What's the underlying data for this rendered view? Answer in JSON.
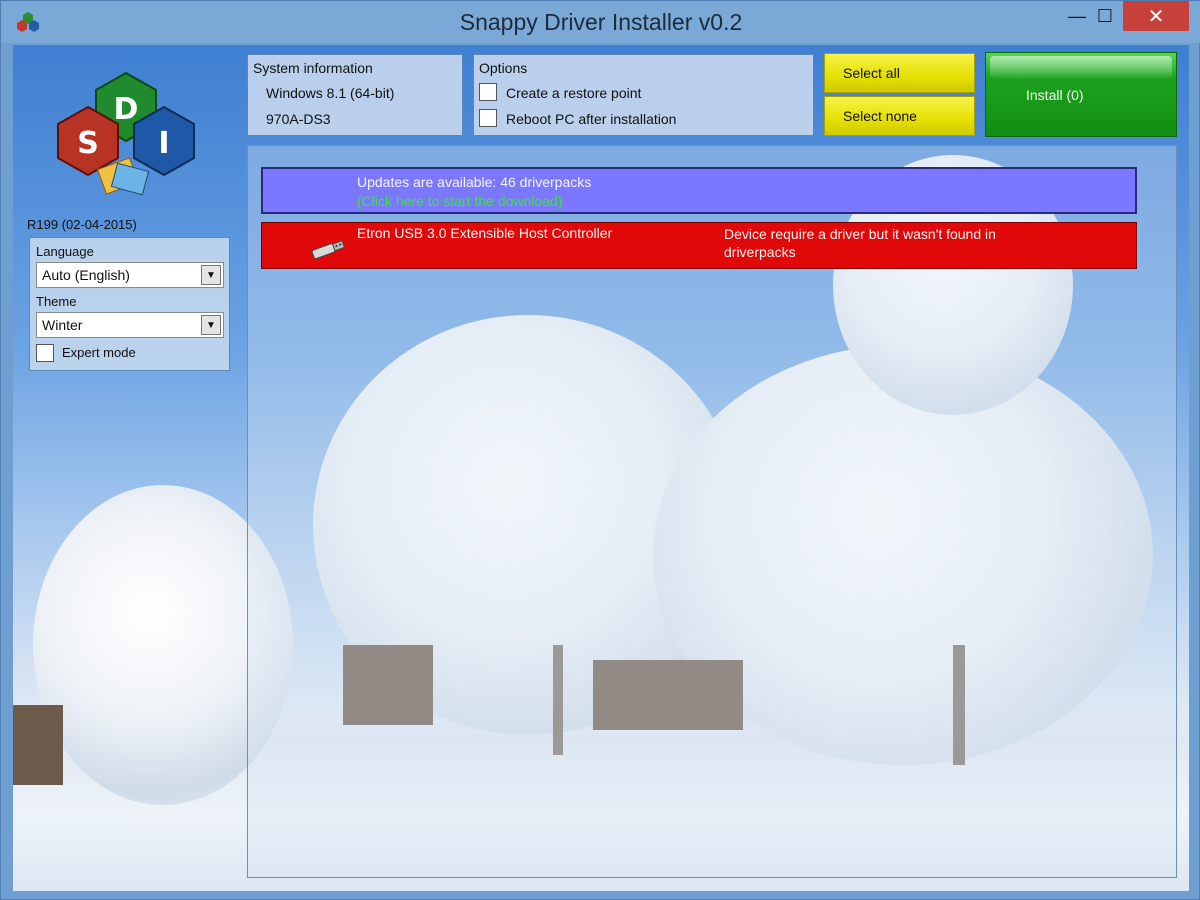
{
  "window": {
    "title": "Snappy Driver Installer v0.2",
    "controls": {
      "minimize": "—",
      "maximize": "☐",
      "close": "✕"
    }
  },
  "sidebar": {
    "revision": "R199 (02-04-2015)",
    "language_label": "Language",
    "language_value": "Auto (English)",
    "theme_label": "Theme",
    "theme_value": "Winter",
    "expert_mode_label": "Expert mode",
    "logo_letters": [
      "D",
      "S",
      "I"
    ]
  },
  "system_info": {
    "title": "System information",
    "os": "Windows 8.1 (64-bit)",
    "board": "970A-DS3"
  },
  "options": {
    "title": "Options",
    "restore_point_label": "Create a restore point",
    "reboot_label": "Reboot PC after installation"
  },
  "buttons": {
    "select_all": "Select all",
    "select_none": "Select none",
    "install": "Install (0)"
  },
  "list": {
    "update_title": "Updates are available: 46 driverpacks",
    "update_link": "(Click here to start the download)",
    "device_name": "Etron USB 3.0 Extensible Host Controller",
    "device_status": "Device require a driver but it wasn't found in driverpacks"
  },
  "colors": {
    "update_bar": "#7b78ff",
    "device_bar": "#e00808",
    "install_green": "#1ea11e",
    "select_yellow": "#e5e000"
  }
}
